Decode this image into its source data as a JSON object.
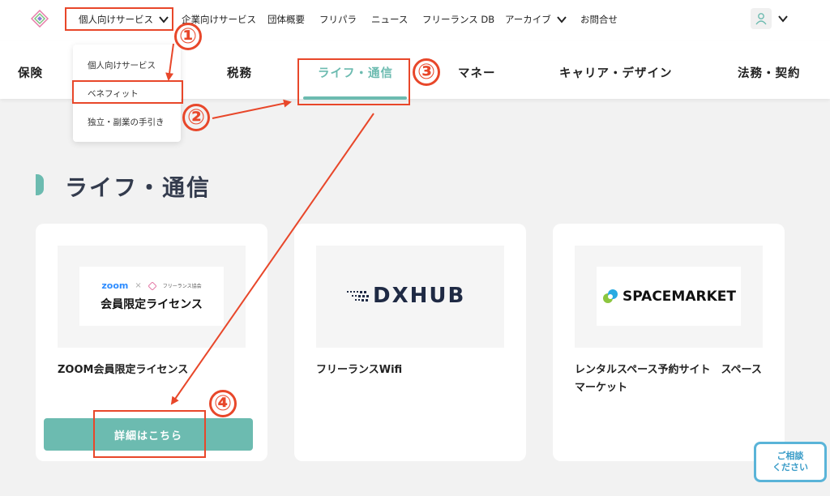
{
  "topnav": {
    "items": [
      {
        "label": "個人向けサービス",
        "has_chevron": true
      },
      {
        "label": "企業向けサービス"
      },
      {
        "label": "団体概要"
      },
      {
        "label": "フリパラ"
      },
      {
        "label": "ニュース"
      },
      {
        "label": "フリーランス DB"
      },
      {
        "label": "アーカイブ",
        "has_chevron": true
      },
      {
        "label": "お問合せ"
      }
    ]
  },
  "dropdown": {
    "items": [
      "個人向けサービス",
      "ベネフィット",
      "独立・副業の手引き"
    ]
  },
  "categories": [
    "保険",
    "税務",
    "ライフ・通信",
    "マネー",
    "キャリア・デザイン",
    "法務・契約"
  ],
  "active_category": "ライフ・通信",
  "section": {
    "title": "ライフ・通信"
  },
  "cards": [
    {
      "logo_top": "zoom",
      "logo_partner": "フリーランス協会",
      "logo_main": "会員限定ライセンス",
      "title": "ZOOM会員限定ライセンス",
      "button": "詳細はこちら"
    },
    {
      "logo_main": "DXHUB",
      "title": "フリーランスWifi"
    },
    {
      "logo_main": "SPACEMARKET",
      "title": "レンタルスペース予約サイト　スペースマーケット"
    }
  ],
  "chat": {
    "line1": "ご相談",
    "line2": "ください"
  },
  "annotations": [
    "①",
    "②",
    "③",
    "④"
  ],
  "colors": {
    "accent": "#6cbbb0",
    "annotation": "#e8472a",
    "chat": "#5ab4d8"
  }
}
